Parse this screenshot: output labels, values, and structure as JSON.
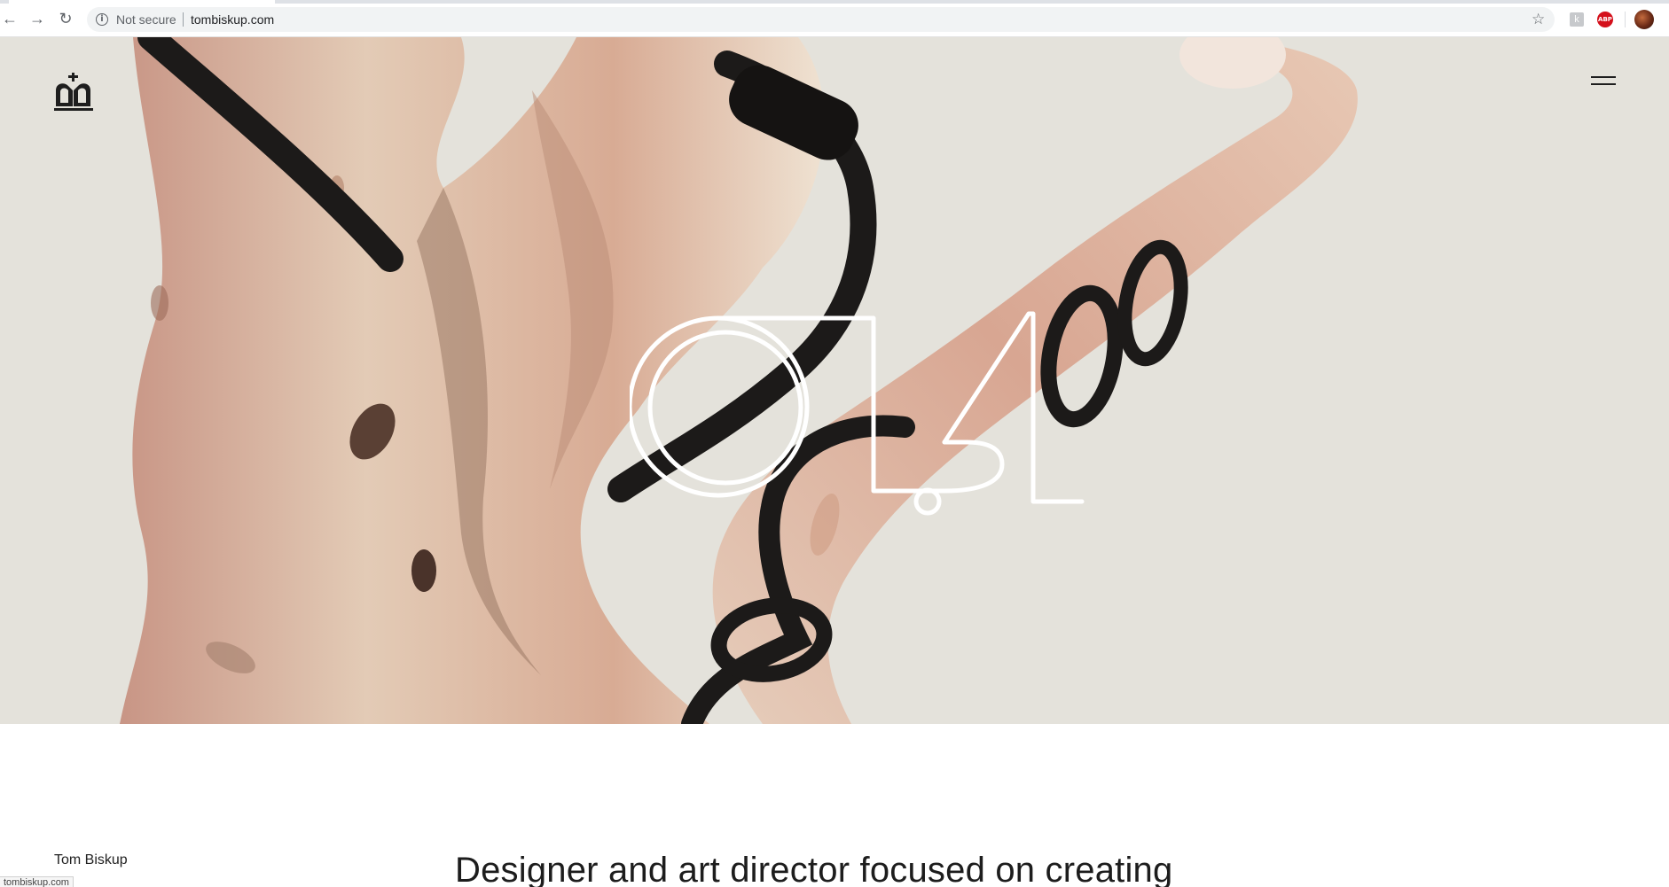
{
  "browser": {
    "security_label": "Not secure",
    "url": "tombiskup.com",
    "icons": {
      "back": "back-arrow-icon",
      "forward": "forward-arrow-icon",
      "reload": "reload-icon",
      "info": "info-icon",
      "bookmark": "star-icon",
      "extension_1": "extension-icon",
      "adblock": "adblock-icon",
      "profile": "profile-avatar-icon"
    },
    "adblock_label": "ABP"
  },
  "hero": {
    "logo_icon": "crown-monogram-icon",
    "menu_icon": "hamburger-menu-icon",
    "artwork": "wood-branch-with-black-cable-photo",
    "center_mark": "oval-line-logo-icon",
    "colors": {
      "background": "#e4e2db",
      "wood": "#d9b6a0",
      "cable": "#1c1a19",
      "mark": "#ffffff"
    }
  },
  "intro": {
    "author": "Tom Biskup",
    "tagline": "Designer and art director focused on creating"
  },
  "status_bar": {
    "text": "tombiskup.com"
  }
}
